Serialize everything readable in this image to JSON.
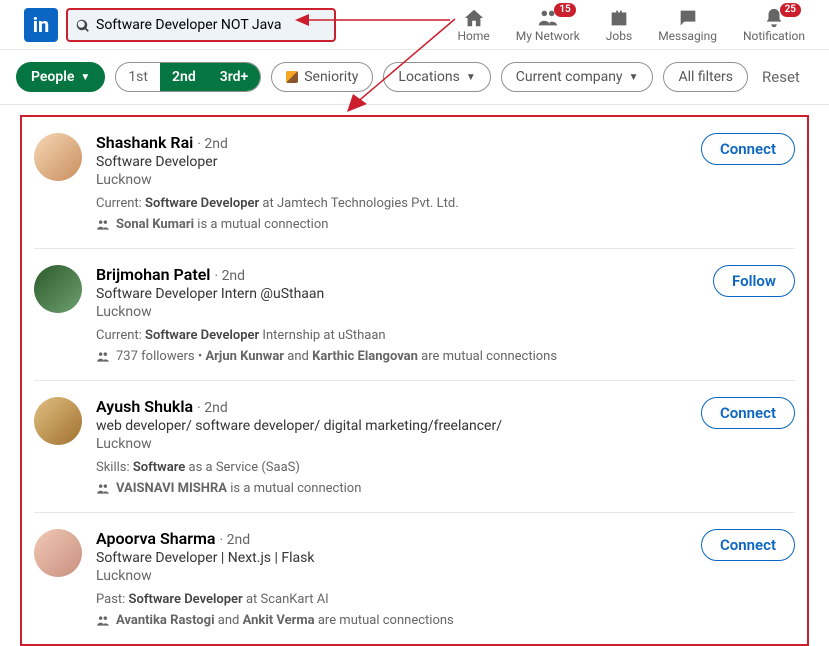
{
  "search": {
    "query": "Software Developer NOT Java"
  },
  "nav": {
    "home": "Home",
    "network": "My Network",
    "network_badge": "15",
    "jobs": "Jobs",
    "messaging": "Messaging",
    "notifications": "Notification",
    "notifications_badge": "25"
  },
  "filters": {
    "people": "People",
    "con1": "1st",
    "con2": "2nd",
    "con3": "3rd+",
    "seniority": "Seniority",
    "locations": "Locations",
    "company": "Current company",
    "all": "All filters",
    "reset": "Reset"
  },
  "results": [
    {
      "name": "Shashank Rai",
      "degree": "· 2nd",
      "headline": "Software Developer",
      "location": "Lucknow",
      "meta_label": "Current:",
      "meta_bold": "Software Developer",
      "meta_rest": " at Jamtech Technologies Pvt. Ltd.",
      "mutual_pre": "",
      "mutual_bold1": "Sonal Kumari",
      "mutual_mid": " is a mutual connection",
      "mutual_bold2": "",
      "mutual_post": "",
      "action": "Connect",
      "avclass": "av1"
    },
    {
      "name": "Brijmohan Patel",
      "degree": "· 2nd",
      "headline": "Software Developer Intern @uSthaan",
      "location": "Lucknow",
      "meta_label": "Current:",
      "meta_bold": "Software Developer",
      "meta_rest": " Internship at uSthaan",
      "mutual_pre": "737 followers • ",
      "mutual_bold1": "Arjun Kunwar",
      "mutual_mid": " and ",
      "mutual_bold2": "Karthic Elangovan",
      "mutual_post": " are mutual connections",
      "action": "Follow",
      "avclass": "av2"
    },
    {
      "name": "Ayush Shukla",
      "degree": "· 2nd",
      "headline": "web developer/ software developer/ digital marketing/freelancer/",
      "location": "Lucknow",
      "meta_label": "Skills:",
      "meta_bold": "Software",
      "meta_rest": " as a Service (SaaS)",
      "mutual_pre": "",
      "mutual_bold1": "VAISNAVI MISHRA",
      "mutual_mid": " is a mutual connection",
      "mutual_bold2": "",
      "mutual_post": "",
      "action": "Connect",
      "avclass": "av3"
    },
    {
      "name": "Apoorva Sharma",
      "degree": "· 2nd",
      "headline": "Software Developer | Next.js | Flask",
      "location": "Lucknow",
      "meta_label": "Past:",
      "meta_bold": "Software Developer",
      "meta_rest": " at ScanKart AI",
      "mutual_pre": "",
      "mutual_bold1": "Avantika Rastogi",
      "mutual_mid": " and ",
      "mutual_bold2": "Ankit Verma",
      "mutual_post": " are mutual connections",
      "action": "Connect",
      "avclass": "av4"
    }
  ]
}
